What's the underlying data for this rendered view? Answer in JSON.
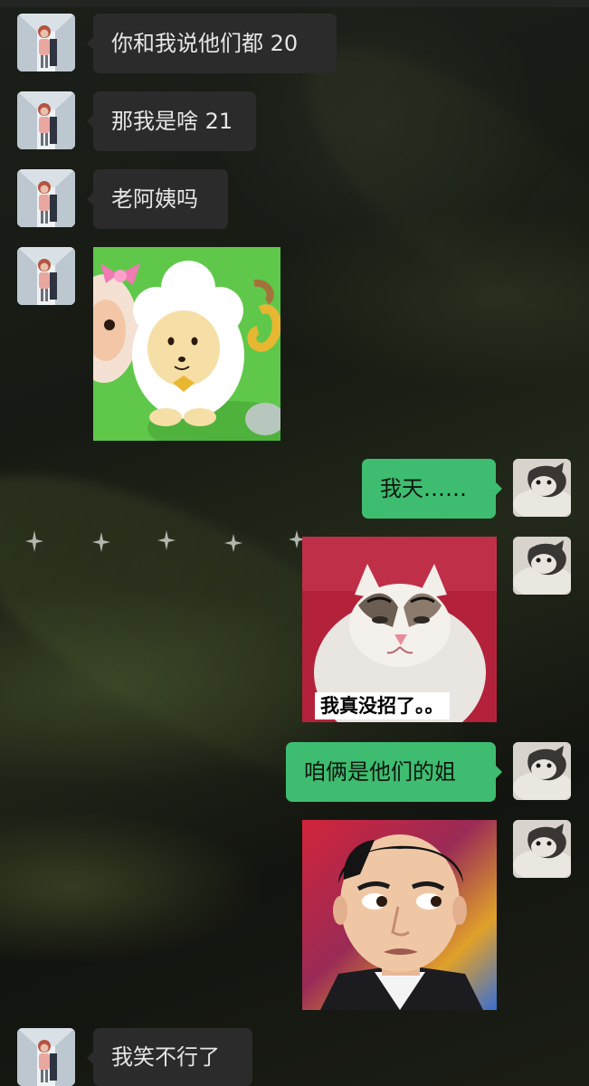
{
  "messages": [
    {
      "side": "left",
      "type": "text",
      "text": "你和我说他们都 20"
    },
    {
      "side": "left",
      "type": "text",
      "text": "那我是啥 21"
    },
    {
      "side": "left",
      "type": "text",
      "text": "老阿姨吗"
    },
    {
      "side": "left",
      "type": "sticker",
      "sticker": "pleasant-goat-sticker"
    },
    {
      "side": "right",
      "type": "text",
      "text": "我天……"
    },
    {
      "side": "right",
      "type": "sticker",
      "sticker": "smug-cat-sticker",
      "caption": "我真没招了。。"
    },
    {
      "side": "right",
      "type": "text",
      "text": "咱俩是他们的姐"
    },
    {
      "side": "right",
      "type": "sticker",
      "sticker": "side-eye-man-sticker"
    },
    {
      "side": "left",
      "type": "text",
      "text": "我笑不行了"
    }
  ],
  "colors": {
    "left_bubble": "#2b2b2b",
    "right_bubble": "#3ebd70",
    "left_text": "#e6e6e6",
    "right_text": "#10160f"
  }
}
